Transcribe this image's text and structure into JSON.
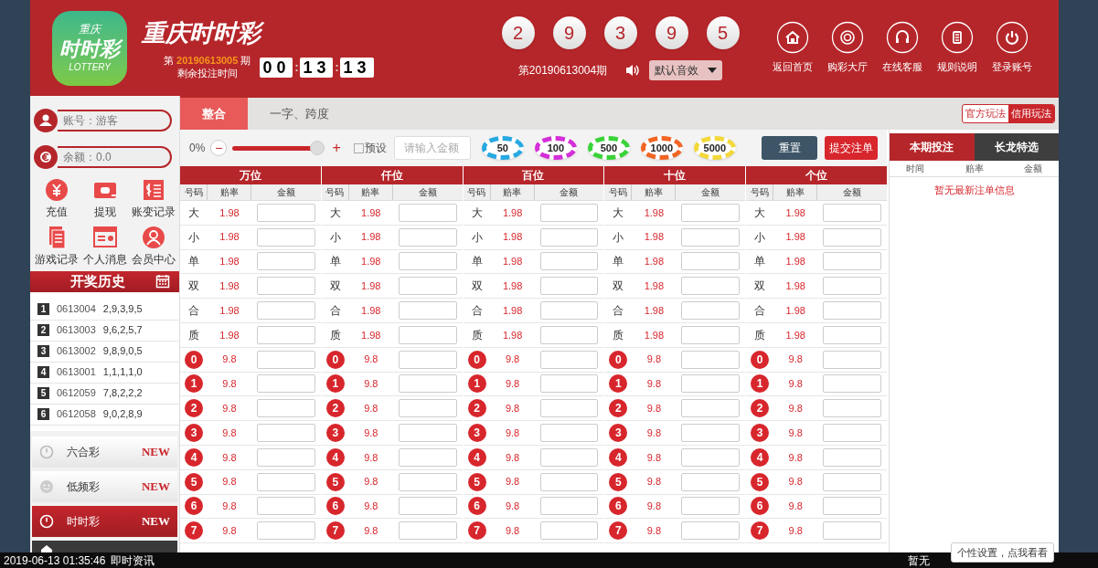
{
  "header": {
    "logo": {
      "top": "重庆",
      "middle": "时时彩",
      "bottom": "LOTTERY"
    },
    "title": "重庆时时彩",
    "period_prefix": "第",
    "period": "20190613005",
    "period_suffix": "期",
    "countdown_label": "剩余投注时间",
    "countdown": [
      "00",
      ":",
      "13",
      ":",
      "13"
    ],
    "balls": [
      "2",
      "9",
      "3",
      "9",
      "5"
    ],
    "last_period": "第20190613004期",
    "sound": "默认音效",
    "nav": [
      {
        "label": "返回首页"
      },
      {
        "label": "购彩大厅"
      },
      {
        "label": "在线客服"
      },
      {
        "label": "规则说明"
      },
      {
        "label": "登录账号"
      }
    ]
  },
  "sidebar": {
    "account": "账号：游客",
    "balance": "余额：0.0",
    "actions": [
      {
        "label": "充值"
      },
      {
        "label": "提现"
      },
      {
        "label": "账变记录"
      },
      {
        "label": "游戏记录"
      },
      {
        "label": "个人消息"
      },
      {
        "label": "会员中心"
      }
    ],
    "history_title": "开奖历史",
    "history": [
      {
        "rank": "1",
        "period": "0613004",
        "numbers": "2,9,3,9,5"
      },
      {
        "rank": "2",
        "period": "0613003",
        "numbers": "9,6,2,5,7"
      },
      {
        "rank": "3",
        "period": "0613002",
        "numbers": "9,8,9,0,5"
      },
      {
        "rank": "4",
        "period": "0613001",
        "numbers": "1,1,1,1,0"
      },
      {
        "rank": "5",
        "period": "0612059",
        "numbers": "7,8,2,2,2"
      },
      {
        "rank": "6",
        "period": "0612058",
        "numbers": "9,0,2,8,9"
      }
    ],
    "games": [
      {
        "kind": "item",
        "label": "六合彩",
        "badge": "NEW",
        "selected": false
      },
      {
        "kind": "item",
        "label": "低频彩",
        "badge": "NEW",
        "selected": false
      },
      {
        "kind": "item",
        "label": "时时彩",
        "badge": "NEW",
        "selected": true
      },
      {
        "kind": "cut",
        "selected": false
      }
    ]
  },
  "tabs": [
    {
      "label": "整合",
      "selected": true
    },
    {
      "label": "一字、跨度",
      "selected": false
    }
  ],
  "modes": [
    {
      "label": "官方玩法",
      "selected": false
    },
    {
      "label": "信用玩法",
      "selected": true
    }
  ],
  "toolbar": {
    "percent": "0%",
    "minus": "−",
    "plus": "+",
    "level": 0.93,
    "preset": {
      "label": "预设",
      "checked": false
    },
    "amount_placeholder": "请输入金额",
    "chips": [
      {
        "label": "50",
        "color": "#27a9e1"
      },
      {
        "label": "100",
        "color": "#d42ed8"
      },
      {
        "label": "500",
        "color": "#3ad43a"
      },
      {
        "label": "1000",
        "color": "#f26522"
      },
      {
        "label": "5000",
        "color": "#f2d83a"
      }
    ],
    "reset": "重置",
    "submit": "提交注单"
  },
  "groups": [
    {
      "name": "万位",
      "columns": [
        "号码",
        "赔率",
        "金额"
      ],
      "rows": [
        {
          "kind": "text",
          "label": "大",
          "odds": "1.98"
        },
        {
          "kind": "text",
          "label": "小",
          "odds": "1.98"
        },
        {
          "kind": "text",
          "label": "单",
          "odds": "1.98"
        },
        {
          "kind": "text",
          "label": "双",
          "odds": "1.98"
        },
        {
          "kind": "text",
          "label": "合",
          "odds": "1.98"
        },
        {
          "kind": "text",
          "label": "质",
          "odds": "1.98"
        },
        {
          "kind": "ball",
          "label": "0",
          "odds": "9.8"
        },
        {
          "kind": "ball",
          "label": "1",
          "odds": "9.8"
        },
        {
          "kind": "ball",
          "label": "2",
          "odds": "9.8"
        },
        {
          "kind": "ball",
          "label": "3",
          "odds": "9.8"
        },
        {
          "kind": "ball",
          "label": "4",
          "odds": "9.8"
        },
        {
          "kind": "ball",
          "label": "5",
          "odds": "9.8"
        },
        {
          "kind": "ball",
          "label": "6",
          "odds": "9.8"
        },
        {
          "kind": "ball",
          "label": "7",
          "odds": "9.8"
        }
      ]
    },
    {
      "name": "仟位",
      "columns": [
        "号码",
        "赔率",
        "金额"
      ],
      "rows": [
        {
          "kind": "text",
          "label": "大",
          "odds": "1.98"
        },
        {
          "kind": "text",
          "label": "小",
          "odds": "1.98"
        },
        {
          "kind": "text",
          "label": "单",
          "odds": "1.98"
        },
        {
          "kind": "text",
          "label": "双",
          "odds": "1.98"
        },
        {
          "kind": "text",
          "label": "合",
          "odds": "1.98"
        },
        {
          "kind": "text",
          "label": "质",
          "odds": "1.98"
        },
        {
          "kind": "ball",
          "label": "0",
          "odds": "9.8"
        },
        {
          "kind": "ball",
          "label": "1",
          "odds": "9.8"
        },
        {
          "kind": "ball",
          "label": "2",
          "odds": "9.8"
        },
        {
          "kind": "ball",
          "label": "3",
          "odds": "9.8"
        },
        {
          "kind": "ball",
          "label": "4",
          "odds": "9.8"
        },
        {
          "kind": "ball",
          "label": "5",
          "odds": "9.8"
        },
        {
          "kind": "ball",
          "label": "6",
          "odds": "9.8"
        },
        {
          "kind": "ball",
          "label": "7",
          "odds": "9.8"
        }
      ]
    },
    {
      "name": "百位",
      "columns": [
        "号码",
        "赔率",
        "金额"
      ],
      "rows": [
        {
          "kind": "text",
          "label": "大",
          "odds": "1.98"
        },
        {
          "kind": "text",
          "label": "小",
          "odds": "1.98"
        },
        {
          "kind": "text",
          "label": "单",
          "odds": "1.98"
        },
        {
          "kind": "text",
          "label": "双",
          "odds": "1.98"
        },
        {
          "kind": "text",
          "label": "合",
          "odds": "1.98"
        },
        {
          "kind": "text",
          "label": "质",
          "odds": "1.98"
        },
        {
          "kind": "ball",
          "label": "0",
          "odds": "9.8"
        },
        {
          "kind": "ball",
          "label": "1",
          "odds": "9.8"
        },
        {
          "kind": "ball",
          "label": "2",
          "odds": "9.8"
        },
        {
          "kind": "ball",
          "label": "3",
          "odds": "9.8"
        },
        {
          "kind": "ball",
          "label": "4",
          "odds": "9.8"
        },
        {
          "kind": "ball",
          "label": "5",
          "odds": "9.8"
        },
        {
          "kind": "ball",
          "label": "6",
          "odds": "9.8"
        },
        {
          "kind": "ball",
          "label": "7",
          "odds": "9.8"
        }
      ]
    },
    {
      "name": "十位",
      "columns": [
        "号码",
        "赔率",
        "金额"
      ],
      "rows": [
        {
          "kind": "text",
          "label": "大",
          "odds": "1.98"
        },
        {
          "kind": "text",
          "label": "小",
          "odds": "1.98"
        },
        {
          "kind": "text",
          "label": "单",
          "odds": "1.98"
        },
        {
          "kind": "text",
          "label": "双",
          "odds": "1.98"
        },
        {
          "kind": "text",
          "label": "合",
          "odds": "1.98"
        },
        {
          "kind": "text",
          "label": "质",
          "odds": "1.98"
        },
        {
          "kind": "ball",
          "label": "0",
          "odds": "9.8"
        },
        {
          "kind": "ball",
          "label": "1",
          "odds": "9.8"
        },
        {
          "kind": "ball",
          "label": "2",
          "odds": "9.8"
        },
        {
          "kind": "ball",
          "label": "3",
          "odds": "9.8"
        },
        {
          "kind": "ball",
          "label": "4",
          "odds": "9.8"
        },
        {
          "kind": "ball",
          "label": "5",
          "odds": "9.8"
        },
        {
          "kind": "ball",
          "label": "6",
          "odds": "9.8"
        },
        {
          "kind": "ball",
          "label": "7",
          "odds": "9.8"
        }
      ]
    },
    {
      "name": "个位",
      "columns": [
        "号码",
        "赔率",
        "金额"
      ],
      "rows": [
        {
          "kind": "text",
          "label": "大",
          "odds": "1.98"
        },
        {
          "kind": "text",
          "label": "小",
          "odds": "1.98"
        },
        {
          "kind": "text",
          "label": "单",
          "odds": "1.98"
        },
        {
          "kind": "text",
          "label": "双",
          "odds": "1.98"
        },
        {
          "kind": "text",
          "label": "合",
          "odds": "1.98"
        },
        {
          "kind": "text",
          "label": "质",
          "odds": "1.98"
        },
        {
          "kind": "ball",
          "label": "0",
          "odds": "9.8"
        },
        {
          "kind": "ball",
          "label": "1",
          "odds": "9.8"
        },
        {
          "kind": "ball",
          "label": "2",
          "odds": "9.8"
        },
        {
          "kind": "ball",
          "label": "3",
          "odds": "9.8"
        },
        {
          "kind": "ball",
          "label": "4",
          "odds": "9.8"
        },
        {
          "kind": "ball",
          "label": "5",
          "odds": "9.8"
        },
        {
          "kind": "ball",
          "label": "6",
          "odds": "9.8"
        },
        {
          "kind": "ball",
          "label": "7",
          "odds": "9.8"
        }
      ]
    }
  ],
  "bets_panel": {
    "tabs": [
      {
        "label": "本期投注",
        "selected": true
      },
      {
        "label": "长龙特选",
        "selected": false
      }
    ],
    "columns": [
      "时间",
      "赔率",
      "金额"
    ],
    "empty": "暂无最新注单信息"
  },
  "footer": {
    "datetime": "2019-06-13 01:35:46",
    "news": "即时资讯",
    "notice": "暂无",
    "tooltip": "个性设置，点我看看"
  }
}
